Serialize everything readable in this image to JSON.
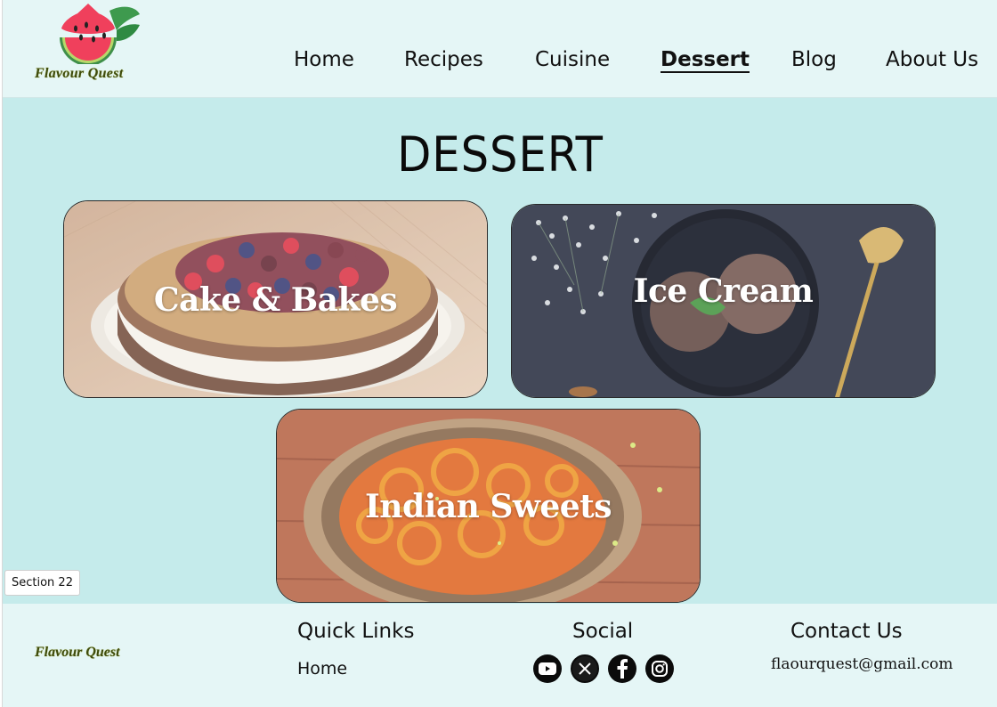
{
  "brand": {
    "name": "Flavour Quest",
    "logo_icon": "watermelon-slice-icon",
    "logo_color": "#3d4a0e"
  },
  "nav": {
    "items": [
      {
        "label": "Home"
      },
      {
        "label": "Recipes"
      },
      {
        "label": "Cuisine"
      },
      {
        "label": "Dessert",
        "active": true
      },
      {
        "label": "Blog"
      },
      {
        "label": "About Us"
      }
    ]
  },
  "main": {
    "title": "DESSERT",
    "cards": [
      {
        "label": "Cake & Bakes",
        "image": "cake-with-berries-photo"
      },
      {
        "label": "Ice Cream",
        "image": "chocolate-ice-cream-photo"
      },
      {
        "label": "Indian Sweets",
        "image": "jalebi-plate-photo"
      }
    ]
  },
  "section_tag": "Section 22",
  "footer": {
    "brand": "Flavour Quest",
    "quick_links": {
      "heading": "Quick Links",
      "items": [
        "Home"
      ]
    },
    "social": {
      "heading": "Social",
      "icons": [
        "youtube-icon",
        "x-twitter-icon",
        "facebook-icon",
        "instagram-icon"
      ]
    },
    "contact": {
      "heading": "Contact Us",
      "email": "flaourquest@gmail.com"
    }
  },
  "colors": {
    "background": "#c5ebeb",
    "header_footer": "#e5f6f6",
    "text": "#111111"
  }
}
